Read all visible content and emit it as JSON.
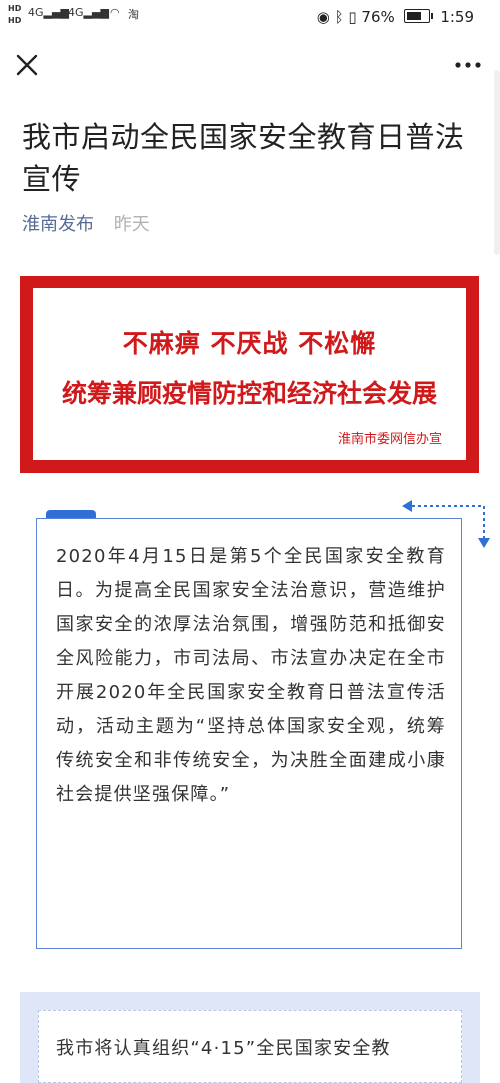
{
  "status_bar": {
    "network_labels": [
      "HD",
      "HD"
    ],
    "signal1": "4G",
    "signal2": "4G",
    "extra": "淘",
    "battery_percent": "76%",
    "time": "1:59"
  },
  "nav": {
    "close_icon": "close-icon",
    "more_icon": "more-icon"
  },
  "article": {
    "title": "我市启动全民国家安全教育日普法宣传",
    "source": "淮南发布",
    "date": "昨天"
  },
  "banner": {
    "line1": "不麻痹  不厌战  不松懈",
    "line2": "统筹兼顾疫情防控和经济社会发展",
    "credit": "淮南市委网信办宣"
  },
  "body": {
    "paragraph1": "2020年4月15日是第5个全民国家安全教育日。为提高全民国家安全法治意识，营造维护国家安全的浓厚法治氛围，增强防范和抵御安全风险能力，市司法局、市法宣办决定在全市开展2020年全民国家安全教育日普法宣传活动，活动主题为“坚持总体国家安全观，统筹传统安全和非传统安全，为决胜全面建成小康社会提供坚强保障。”",
    "paragraph2": "我市将认真组织“4·15”全民国家安全教"
  },
  "colors": {
    "banner_red": "#d0191a",
    "link_blue": "#576b95",
    "frame_blue": "#5b84d8"
  }
}
